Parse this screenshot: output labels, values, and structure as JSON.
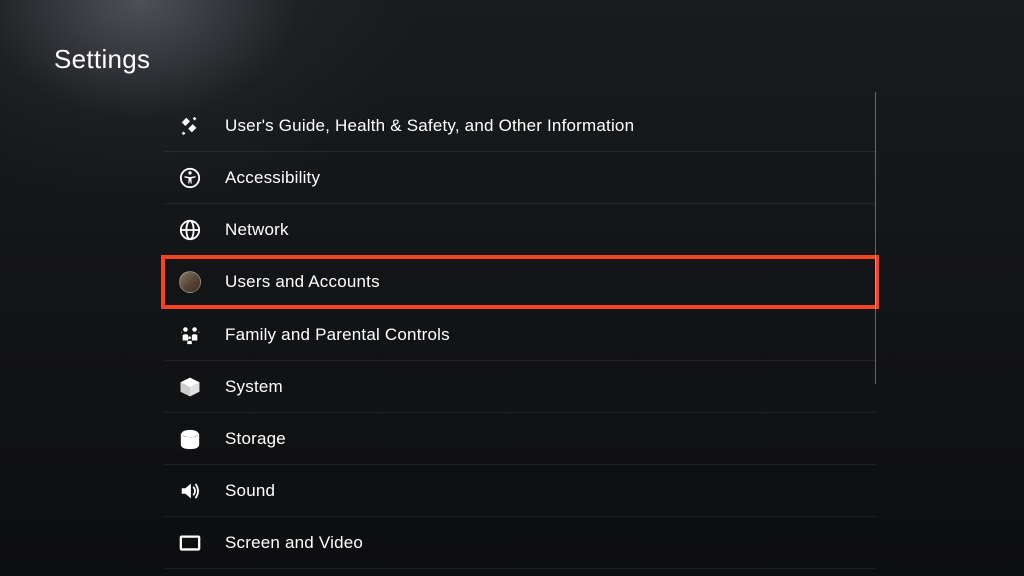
{
  "page": {
    "title": "Settings"
  },
  "menu": {
    "items": [
      {
        "id": "guide",
        "label": "User's Guide, Health & Safety, and Other Information",
        "icon": "guide-icon",
        "highlighted": false
      },
      {
        "id": "accessibility",
        "label": "Accessibility",
        "icon": "accessibility-icon",
        "highlighted": false
      },
      {
        "id": "network",
        "label": "Network",
        "icon": "globe-icon",
        "highlighted": false
      },
      {
        "id": "users",
        "label": "Users and Accounts",
        "icon": "avatar-icon",
        "highlighted": true
      },
      {
        "id": "family",
        "label": "Family and Parental Controls",
        "icon": "family-icon",
        "highlighted": false
      },
      {
        "id": "system",
        "label": "System",
        "icon": "cube-icon",
        "highlighted": false
      },
      {
        "id": "storage",
        "label": "Storage",
        "icon": "storage-icon",
        "highlighted": false
      },
      {
        "id": "sound",
        "label": "Sound",
        "icon": "speaker-icon",
        "highlighted": false
      },
      {
        "id": "screen",
        "label": "Screen and Video",
        "icon": "screen-icon",
        "highlighted": false
      }
    ]
  },
  "highlight_color": "#f54423"
}
